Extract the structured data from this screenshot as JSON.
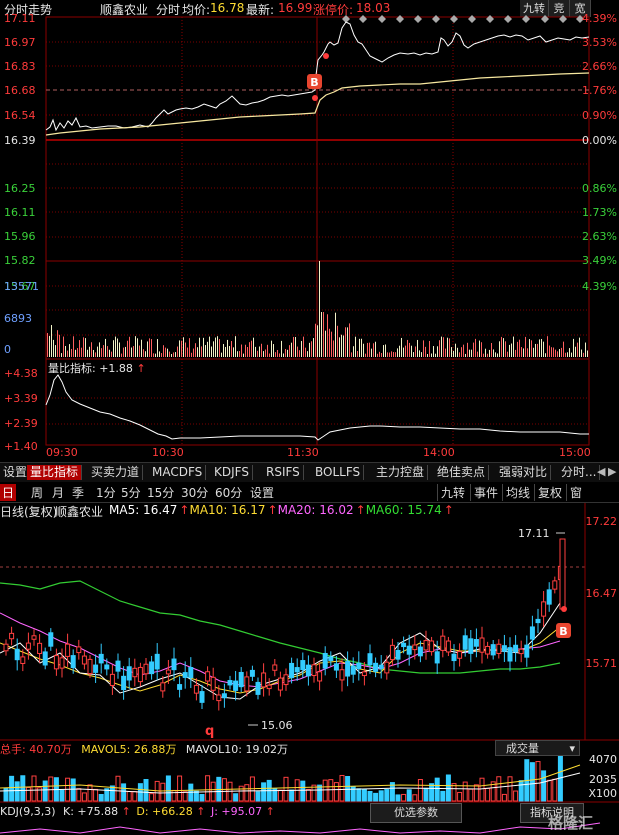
{
  "intraday": {
    "header": {
      "title": "分时走势",
      "stock_name": "顺鑫农业",
      "mode": "分时",
      "avg_label": "均价:",
      "avg_value": "16.78",
      "last_label": "最新:",
      "last_value": "16.99",
      "limit_label": "涨停价:",
      "limit_value": "18.03",
      "buttons": [
        "九转",
        "竞",
        "宽"
      ]
    },
    "price_labels": [
      "17.11",
      "16.97",
      "16.83",
      "16.68",
      "16.54",
      "16.39",
      "16.25",
      "16.11",
      "15.96",
      "15.82",
      "15.67"
    ],
    "pct_labels": [
      "4.39%",
      "3.53%",
      "2.66%",
      "1.76%",
      "0.90%",
      "0.00%",
      "0.86%",
      "1.73%",
      "2.63%",
      "3.49%",
      "4.39%"
    ],
    "volume_labels": [
      "13571",
      "6893",
      "0"
    ],
    "ratio_title": "量比指标:",
    "ratio_value": "+1.88",
    "ratio_arrow": "↑",
    "ratio_labels": [
      "+4.38",
      "+3.39",
      "+2.39",
      "+1.40"
    ],
    "time_labels": [
      "09:30",
      "10:30",
      "11:30",
      "14:00",
      "15:00"
    ],
    "buy_marker": "B",
    "colors": {
      "up": "#ff3b3b",
      "down": "#3ad13a",
      "price_line": "#ffffff",
      "avg_line": "#f7e8a0",
      "grid": "#8b0000"
    }
  },
  "indicator_tabs": [
    "设置",
    "量比指标",
    "买卖力道",
    "MACDFS",
    "KDJFS",
    "RSIFS",
    "BOLLFS",
    "主力控盘",
    "绝佳卖点",
    "强弱对比",
    "分时..."
  ],
  "indicator_tab_active": "量比指标",
  "period_tabs": [
    "日",
    "周",
    "月",
    "季",
    "年",
    "1分",
    "5分",
    "15分",
    "30分",
    "60分",
    "设置"
  ],
  "period_tab_active": "日",
  "period_right_tabs": [
    "九转",
    "事件",
    "均线",
    "复权",
    "窗"
  ],
  "kline": {
    "title": "日线(复权)",
    "stock_name": "顺鑫农业",
    "ma_items": [
      {
        "label": "MA5: 16.47",
        "arrow": "↑",
        "color": "#ffffff"
      },
      {
        "label": "MA10: 16.17",
        "arrow": "↑",
        "color": "#ffdd33"
      },
      {
        "label": "MA20: 16.02",
        "arrow": "↑",
        "color": "#ff66ff"
      },
      {
        "label": "MA60: 15.74",
        "arrow": "↑",
        "color": "#33dd33"
      }
    ],
    "price_labels": [
      "17.22",
      "16.47",
      "15.71"
    ],
    "high_annotation": "17.11",
    "low_annotation": "15.06",
    "buy_marker": "B",
    "q_marker": "q"
  },
  "volume_panel": {
    "title": "总手: 40.70万",
    "mavol5": "MAVOL5: 26.88万",
    "mavol10": "MAVOL10: 19.02万",
    "dropdown": "成交量",
    "scale_labels": [
      "4070",
      "2035",
      "X100"
    ]
  },
  "kdj_panel": {
    "title": "KDJ(9,3,3)",
    "k": "K: +75.88",
    "d": "D: +66.28",
    "j": "J: +95.07",
    "arrow": "↑",
    "popup_button": "优选参数",
    "help_button": "指标说明",
    "watermark": "格隆汇"
  }
}
